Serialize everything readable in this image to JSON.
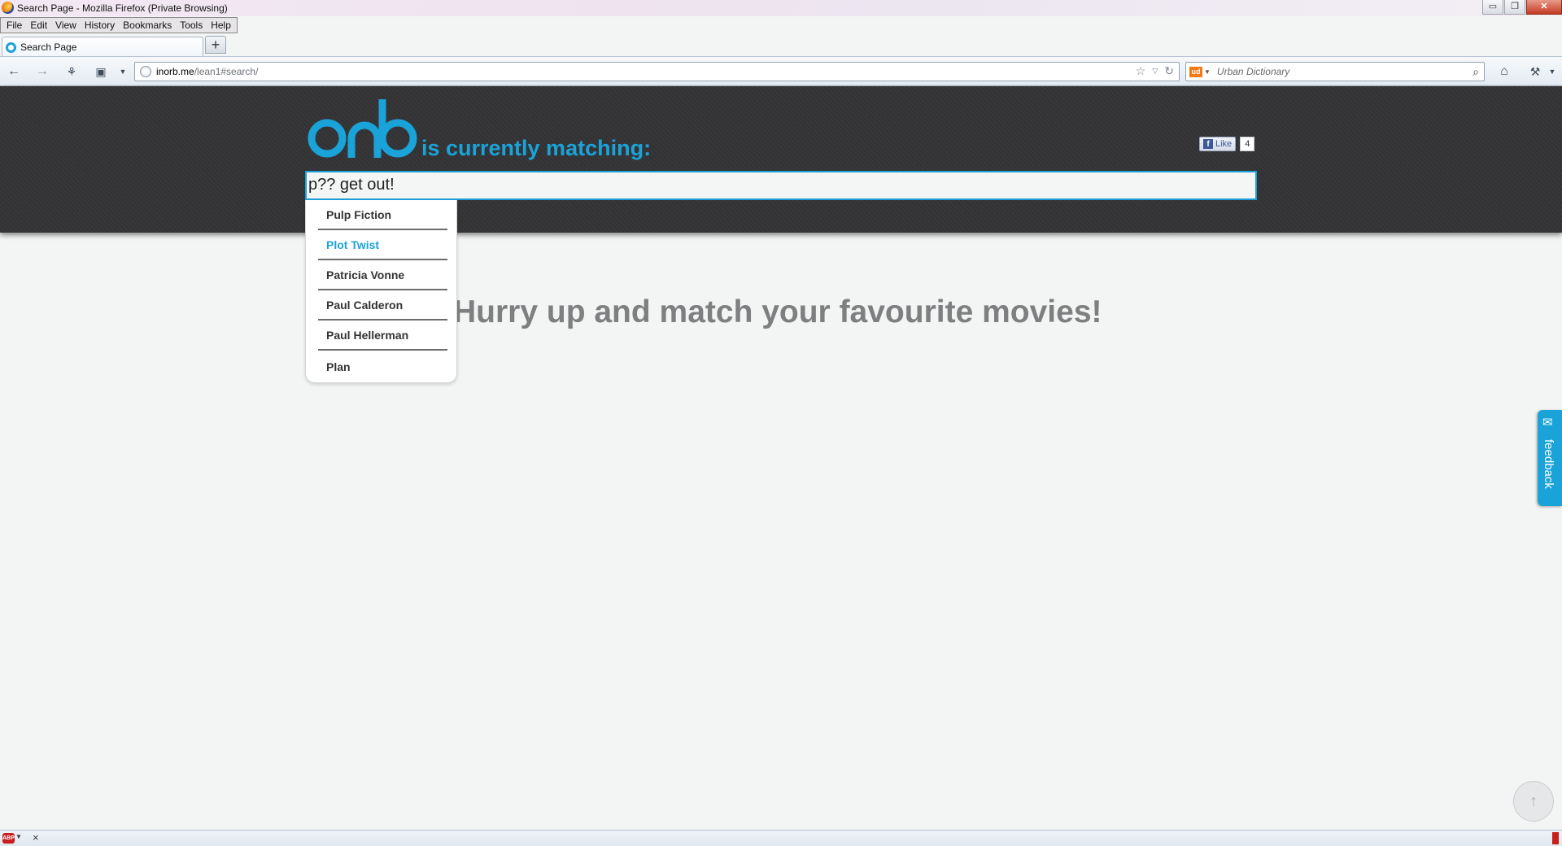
{
  "window": {
    "title": "Search Page - Mozilla Firefox (Private Browsing)",
    "controls": {
      "minimize": "▭",
      "restore": "❐",
      "close": "✕"
    }
  },
  "menubar": [
    "File",
    "Edit",
    "View",
    "History",
    "Bookmarks",
    "Tools",
    "Help"
  ],
  "tabs": [
    {
      "label": "Search Page",
      "active": true
    }
  ],
  "new_tab_label": "+",
  "toolbar": {
    "url_domain": "inorb.me",
    "url_path": "/lean1#search/",
    "search_engine": "Urban Dictionary",
    "search_engine_badge": "ud"
  },
  "page": {
    "logo_text": "orb",
    "tagline": "is currently matching:",
    "fb_like_label": "Like",
    "fb_like_count": "4",
    "search_value": "p?? get out!",
    "headline": "Hurry up and match your favourite movies!",
    "suggestions": [
      {
        "label": "Pulp Fiction",
        "active": false
      },
      {
        "label": "Plot Twist",
        "active": true
      },
      {
        "label": "Patricia Vonne",
        "active": false
      },
      {
        "label": "Paul Calderon",
        "active": false
      },
      {
        "label": "Paul Hellerman",
        "active": false
      },
      {
        "label": "Plan",
        "active": false
      }
    ],
    "feedback_label": "feedback",
    "scroll_top_label": "↑"
  },
  "statusbar": {
    "abp_badge": "ABP",
    "close": "×"
  },
  "colors": {
    "accent": "#1aa3d8",
    "header_bg": "#333335",
    "headline": "#7d7f80"
  },
  "icons": [
    "firefox-icon",
    "back-icon",
    "forward-icon",
    "addons-icon",
    "screenshot-icon",
    "dropdown-icon",
    "globe-icon",
    "bookmark-star-icon",
    "history-dropdown-icon",
    "reload-icon",
    "search-icon",
    "home-icon",
    "tools-icon",
    "megaphone-icon",
    "adblock-icon"
  ]
}
